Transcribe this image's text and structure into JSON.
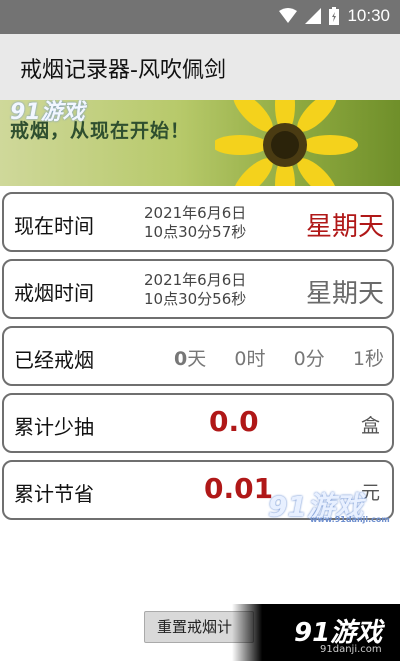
{
  "status": {
    "time": "10:30"
  },
  "app": {
    "title": "戒烟记录器-风吹佩剑"
  },
  "banner": {
    "slogan": "戒烟，从现在开始！",
    "logo": "91游戏"
  },
  "cards": {
    "now": {
      "label": "现在时间",
      "date": "2021年6月6日",
      "time": "10点30分57秒",
      "weekday": "星期天"
    },
    "quit": {
      "label": "戒烟时间",
      "date": "2021年6月6日",
      "time": "10点30分56秒",
      "weekday": "星期天"
    },
    "elapsed": {
      "label": "已经戒烟",
      "days_value": "0",
      "days_unit": "天",
      "hours": "0时",
      "minutes": "0分",
      "seconds": "1秒"
    },
    "less_smoked": {
      "label": "累计少抽",
      "value": "0.0",
      "unit": "盒"
    },
    "saved": {
      "label": "累计节省",
      "value": "0.01",
      "unit": "元"
    }
  },
  "watermarks": {
    "middle": "91游戏",
    "middle_url": "www.91danji.com",
    "bottom": "91游戏",
    "bottom_url": "91danji.com"
  },
  "actions": {
    "reset": "重置戒烟计"
  }
}
